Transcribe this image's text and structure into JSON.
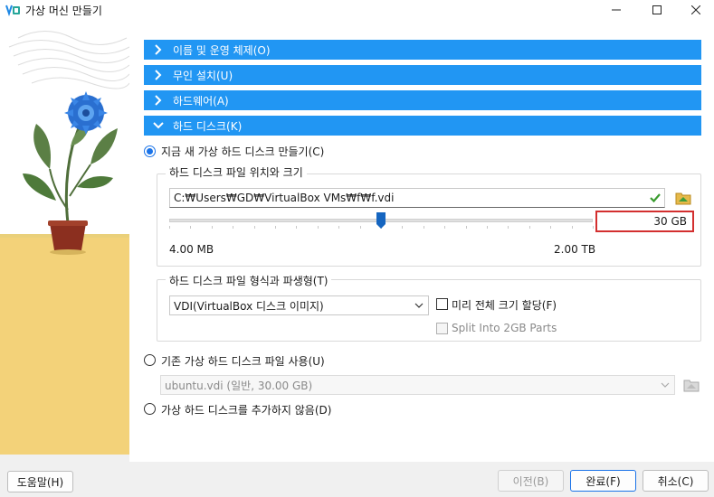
{
  "window": {
    "title": "가상 머신 만들기"
  },
  "sections": [
    {
      "label": "이름 및 운영 체제(O)",
      "expanded": false
    },
    {
      "label": "무인 설치(U)",
      "expanded": false
    },
    {
      "label": "하드웨어(A)",
      "expanded": false
    },
    {
      "label": "하드 디스크(K)",
      "expanded": true
    }
  ],
  "disk": {
    "option_new": "지금 새 가상 하드 디스크 만들기(C)",
    "location_group": "하드 디스크 파일 위치와 크기",
    "file_path": "C:₩Users₩GD₩VirtualBox VMs₩f₩f.vdi",
    "size_value": "30 GB",
    "size_fraction": 0.5,
    "size_min": "4.00 MB",
    "size_max": "2.00 TB",
    "format_group": "하드 디스크 파일 형식과 파생형(T)",
    "format_selected": "VDI(VirtualBox 디스크 이미지)",
    "preallocate_label": "미리 전체 크기 할당(F)",
    "split_label": "Split Into 2GB Parts",
    "option_existing": "기존 가상 하드 디스크 파일 사용(U)",
    "existing_selected": "ubuntu.vdi (일반, 30.00 GB)",
    "option_none": "가상 하드 디스크를 추가하지 않음(D)"
  },
  "footer": {
    "help": "도움말(H)",
    "back": "이전(B)",
    "finish": "완료(F)",
    "cancel": "취소(C)"
  },
  "colors": {
    "section_bg": "#2196f3",
    "highlight_border": "#d32f2f",
    "accent": "#1a73e8"
  }
}
